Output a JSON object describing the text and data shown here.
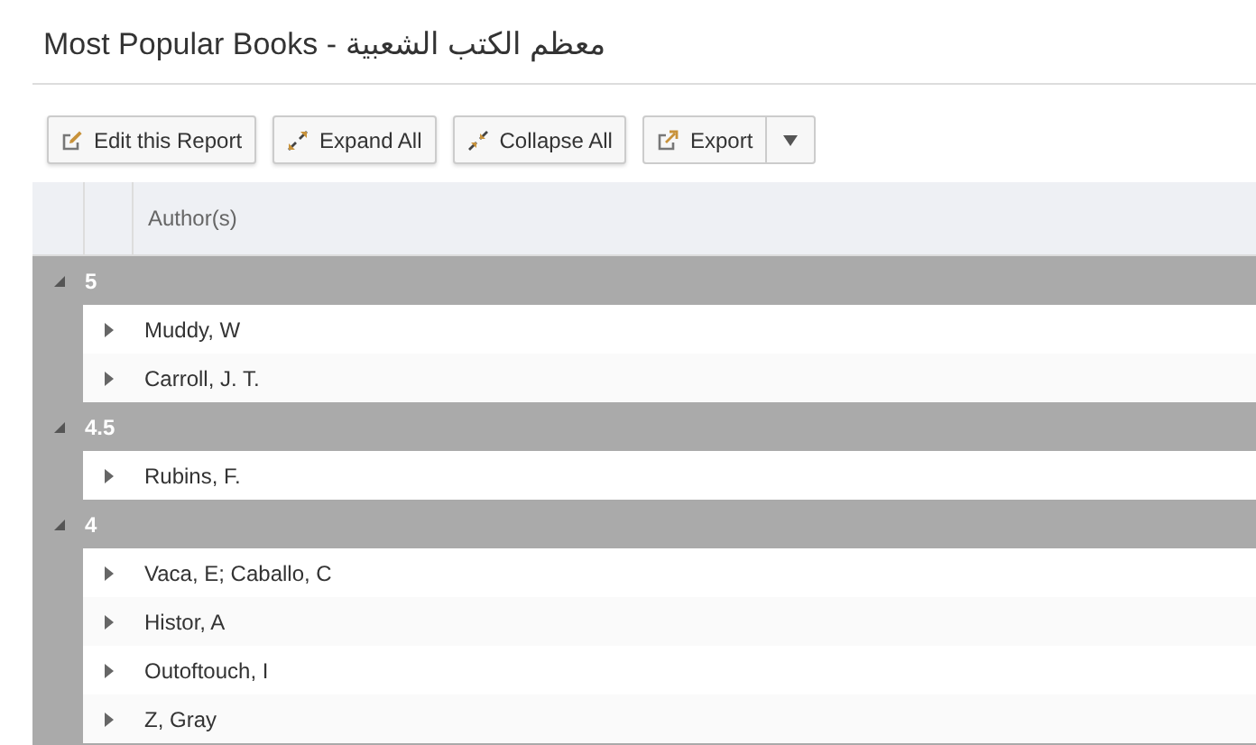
{
  "page": {
    "title": "Most Popular Books - معظم الكتب الشعبية"
  },
  "toolbar": {
    "buttons": [
      {
        "label": "Edit this Report",
        "kind": "edit"
      },
      {
        "label": "Expand All",
        "kind": "expand"
      },
      {
        "label": "Collapse All",
        "kind": "collapse"
      },
      {
        "label": "Export",
        "kind": "export"
      }
    ]
  },
  "grid": {
    "columns": [
      "Author(s)"
    ],
    "groups": [
      {
        "label": "5",
        "expanded": true,
        "rows": [
          {
            "author": "Muddy, W",
            "expanded": false
          },
          {
            "author": "Carroll, J. T.",
            "expanded": false
          }
        ]
      },
      {
        "label": "4.5",
        "expanded": true,
        "rows": [
          {
            "author": "Rubins, F.",
            "expanded": false
          }
        ]
      },
      {
        "label": "4",
        "expanded": true,
        "rows": [
          {
            "author": "Vaca, E; Caballo, C",
            "expanded": false
          },
          {
            "author": "Histor, A",
            "expanded": false
          },
          {
            "author": "Outoftouch, I",
            "expanded": false
          },
          {
            "author": "Z, Gray",
            "expanded": false
          }
        ]
      }
    ]
  }
}
